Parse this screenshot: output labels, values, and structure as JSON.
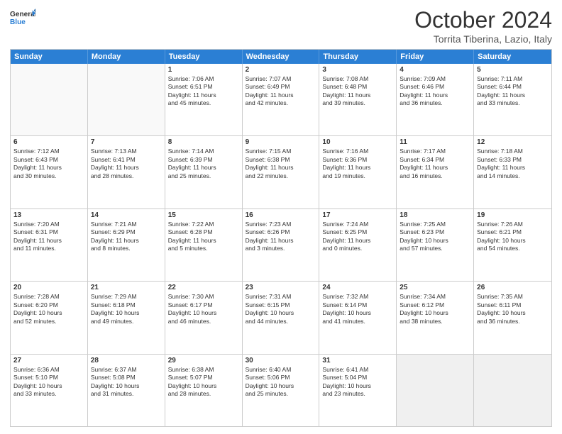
{
  "logo": {
    "general": "General",
    "blue": "Blue"
  },
  "header": {
    "month": "October 2024",
    "location": "Torrita Tiberina, Lazio, Italy"
  },
  "weekdays": [
    "Sunday",
    "Monday",
    "Tuesday",
    "Wednesday",
    "Thursday",
    "Friday",
    "Saturday"
  ],
  "rows": [
    [
      {
        "day": "",
        "lines": [],
        "empty": true
      },
      {
        "day": "",
        "lines": [],
        "empty": true
      },
      {
        "day": "1",
        "lines": [
          "Sunrise: 7:06 AM",
          "Sunset: 6:51 PM",
          "Daylight: 11 hours",
          "and 45 minutes."
        ]
      },
      {
        "day": "2",
        "lines": [
          "Sunrise: 7:07 AM",
          "Sunset: 6:49 PM",
          "Daylight: 11 hours",
          "and 42 minutes."
        ]
      },
      {
        "day": "3",
        "lines": [
          "Sunrise: 7:08 AM",
          "Sunset: 6:48 PM",
          "Daylight: 11 hours",
          "and 39 minutes."
        ]
      },
      {
        "day": "4",
        "lines": [
          "Sunrise: 7:09 AM",
          "Sunset: 6:46 PM",
          "Daylight: 11 hours",
          "and 36 minutes."
        ]
      },
      {
        "day": "5",
        "lines": [
          "Sunrise: 7:11 AM",
          "Sunset: 6:44 PM",
          "Daylight: 11 hours",
          "and 33 minutes."
        ]
      }
    ],
    [
      {
        "day": "6",
        "lines": [
          "Sunrise: 7:12 AM",
          "Sunset: 6:43 PM",
          "Daylight: 11 hours",
          "and 30 minutes."
        ]
      },
      {
        "day": "7",
        "lines": [
          "Sunrise: 7:13 AM",
          "Sunset: 6:41 PM",
          "Daylight: 11 hours",
          "and 28 minutes."
        ]
      },
      {
        "day": "8",
        "lines": [
          "Sunrise: 7:14 AM",
          "Sunset: 6:39 PM",
          "Daylight: 11 hours",
          "and 25 minutes."
        ]
      },
      {
        "day": "9",
        "lines": [
          "Sunrise: 7:15 AM",
          "Sunset: 6:38 PM",
          "Daylight: 11 hours",
          "and 22 minutes."
        ]
      },
      {
        "day": "10",
        "lines": [
          "Sunrise: 7:16 AM",
          "Sunset: 6:36 PM",
          "Daylight: 11 hours",
          "and 19 minutes."
        ]
      },
      {
        "day": "11",
        "lines": [
          "Sunrise: 7:17 AM",
          "Sunset: 6:34 PM",
          "Daylight: 11 hours",
          "and 16 minutes."
        ]
      },
      {
        "day": "12",
        "lines": [
          "Sunrise: 7:18 AM",
          "Sunset: 6:33 PM",
          "Daylight: 11 hours",
          "and 14 minutes."
        ]
      }
    ],
    [
      {
        "day": "13",
        "lines": [
          "Sunrise: 7:20 AM",
          "Sunset: 6:31 PM",
          "Daylight: 11 hours",
          "and 11 minutes."
        ]
      },
      {
        "day": "14",
        "lines": [
          "Sunrise: 7:21 AM",
          "Sunset: 6:29 PM",
          "Daylight: 11 hours",
          "and 8 minutes."
        ]
      },
      {
        "day": "15",
        "lines": [
          "Sunrise: 7:22 AM",
          "Sunset: 6:28 PM",
          "Daylight: 11 hours",
          "and 5 minutes."
        ]
      },
      {
        "day": "16",
        "lines": [
          "Sunrise: 7:23 AM",
          "Sunset: 6:26 PM",
          "Daylight: 11 hours",
          "and 3 minutes."
        ]
      },
      {
        "day": "17",
        "lines": [
          "Sunrise: 7:24 AM",
          "Sunset: 6:25 PM",
          "Daylight: 11 hours",
          "and 0 minutes."
        ]
      },
      {
        "day": "18",
        "lines": [
          "Sunrise: 7:25 AM",
          "Sunset: 6:23 PM",
          "Daylight: 10 hours",
          "and 57 minutes."
        ]
      },
      {
        "day": "19",
        "lines": [
          "Sunrise: 7:26 AM",
          "Sunset: 6:21 PM",
          "Daylight: 10 hours",
          "and 54 minutes."
        ]
      }
    ],
    [
      {
        "day": "20",
        "lines": [
          "Sunrise: 7:28 AM",
          "Sunset: 6:20 PM",
          "Daylight: 10 hours",
          "and 52 minutes."
        ]
      },
      {
        "day": "21",
        "lines": [
          "Sunrise: 7:29 AM",
          "Sunset: 6:18 PM",
          "Daylight: 10 hours",
          "and 49 minutes."
        ]
      },
      {
        "day": "22",
        "lines": [
          "Sunrise: 7:30 AM",
          "Sunset: 6:17 PM",
          "Daylight: 10 hours",
          "and 46 minutes."
        ]
      },
      {
        "day": "23",
        "lines": [
          "Sunrise: 7:31 AM",
          "Sunset: 6:15 PM",
          "Daylight: 10 hours",
          "and 44 minutes."
        ]
      },
      {
        "day": "24",
        "lines": [
          "Sunrise: 7:32 AM",
          "Sunset: 6:14 PM",
          "Daylight: 10 hours",
          "and 41 minutes."
        ]
      },
      {
        "day": "25",
        "lines": [
          "Sunrise: 7:34 AM",
          "Sunset: 6:12 PM",
          "Daylight: 10 hours",
          "and 38 minutes."
        ]
      },
      {
        "day": "26",
        "lines": [
          "Sunrise: 7:35 AM",
          "Sunset: 6:11 PM",
          "Daylight: 10 hours",
          "and 36 minutes."
        ]
      }
    ],
    [
      {
        "day": "27",
        "lines": [
          "Sunrise: 6:36 AM",
          "Sunset: 5:10 PM",
          "Daylight: 10 hours",
          "and 33 minutes."
        ]
      },
      {
        "day": "28",
        "lines": [
          "Sunrise: 6:37 AM",
          "Sunset: 5:08 PM",
          "Daylight: 10 hours",
          "and 31 minutes."
        ]
      },
      {
        "day": "29",
        "lines": [
          "Sunrise: 6:38 AM",
          "Sunset: 5:07 PM",
          "Daylight: 10 hours",
          "and 28 minutes."
        ]
      },
      {
        "day": "30",
        "lines": [
          "Sunrise: 6:40 AM",
          "Sunset: 5:06 PM",
          "Daylight: 10 hours",
          "and 25 minutes."
        ]
      },
      {
        "day": "31",
        "lines": [
          "Sunrise: 6:41 AM",
          "Sunset: 5:04 PM",
          "Daylight: 10 hours",
          "and 23 minutes."
        ]
      },
      {
        "day": "",
        "lines": [],
        "empty": true,
        "shaded": true
      },
      {
        "day": "",
        "lines": [],
        "empty": true,
        "shaded": true
      }
    ]
  ]
}
